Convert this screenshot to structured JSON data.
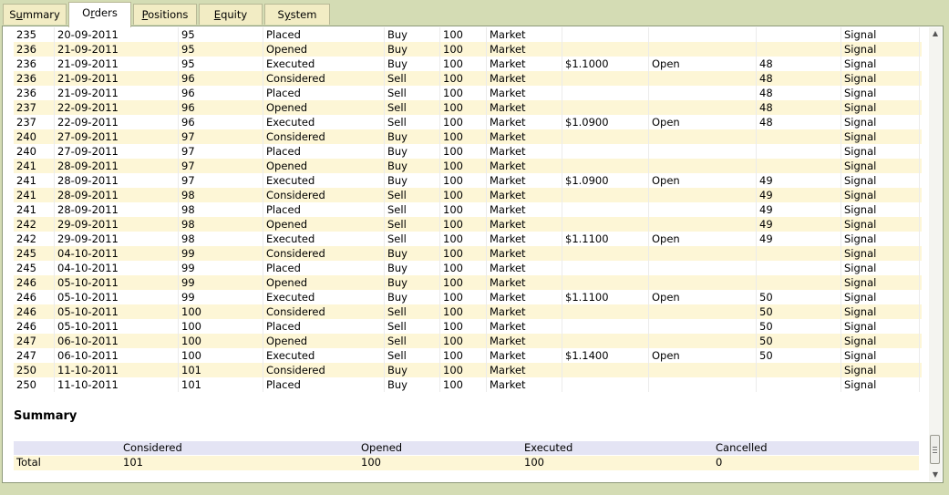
{
  "tabs": [
    {
      "name": "summary",
      "pre": "S",
      "ul": "u",
      "post": "mmary",
      "active": false
    },
    {
      "name": "orders",
      "pre": "O",
      "ul": "r",
      "post": "ders",
      "active": true
    },
    {
      "name": "positions",
      "pre": "",
      "ul": "P",
      "post": "ositions",
      "active": false
    },
    {
      "name": "equity",
      "pre": "",
      "ul": "E",
      "post": "quity",
      "active": false
    },
    {
      "name": "system",
      "pre": "S",
      "ul": "y",
      "post": "stem",
      "active": false
    }
  ],
  "orders": [
    [
      "235",
      "20-09-2011",
      "95",
      "Placed",
      "Buy",
      "100",
      "Market",
      "",
      "",
      "",
      "Signal"
    ],
    [
      "236",
      "21-09-2011",
      "95",
      "Opened",
      "Buy",
      "100",
      "Market",
      "",
      "",
      "",
      "Signal"
    ],
    [
      "236",
      "21-09-2011",
      "95",
      "Executed",
      "Buy",
      "100",
      "Market",
      "$1.1000",
      "Open",
      "48",
      "Signal"
    ],
    [
      "236",
      "21-09-2011",
      "96",
      "Considered",
      "Sell",
      "100",
      "Market",
      "",
      "",
      "48",
      "Signal"
    ],
    [
      "236",
      "21-09-2011",
      "96",
      "Placed",
      "Sell",
      "100",
      "Market",
      "",
      "",
      "48",
      "Signal"
    ],
    [
      "237",
      "22-09-2011",
      "96",
      "Opened",
      "Sell",
      "100",
      "Market",
      "",
      "",
      "48",
      "Signal"
    ],
    [
      "237",
      "22-09-2011",
      "96",
      "Executed",
      "Sell",
      "100",
      "Market",
      "$1.0900",
      "Open",
      "48",
      "Signal"
    ],
    [
      "240",
      "27-09-2011",
      "97",
      "Considered",
      "Buy",
      "100",
      "Market",
      "",
      "",
      "",
      "Signal"
    ],
    [
      "240",
      "27-09-2011",
      "97",
      "Placed",
      "Buy",
      "100",
      "Market",
      "",
      "",
      "",
      "Signal"
    ],
    [
      "241",
      "28-09-2011",
      "97",
      "Opened",
      "Buy",
      "100",
      "Market",
      "",
      "",
      "",
      "Signal"
    ],
    [
      "241",
      "28-09-2011",
      "97",
      "Executed",
      "Buy",
      "100",
      "Market",
      "$1.0900",
      "Open",
      "49",
      "Signal"
    ],
    [
      "241",
      "28-09-2011",
      "98",
      "Considered",
      "Sell",
      "100",
      "Market",
      "",
      "",
      "49",
      "Signal"
    ],
    [
      "241",
      "28-09-2011",
      "98",
      "Placed",
      "Sell",
      "100",
      "Market",
      "",
      "",
      "49",
      "Signal"
    ],
    [
      "242",
      "29-09-2011",
      "98",
      "Opened",
      "Sell",
      "100",
      "Market",
      "",
      "",
      "49",
      "Signal"
    ],
    [
      "242",
      "29-09-2011",
      "98",
      "Executed",
      "Sell",
      "100",
      "Market",
      "$1.1100",
      "Open",
      "49",
      "Signal"
    ],
    [
      "245",
      "04-10-2011",
      "99",
      "Considered",
      "Buy",
      "100",
      "Market",
      "",
      "",
      "",
      "Signal"
    ],
    [
      "245",
      "04-10-2011",
      "99",
      "Placed",
      "Buy",
      "100",
      "Market",
      "",
      "",
      "",
      "Signal"
    ],
    [
      "246",
      "05-10-2011",
      "99",
      "Opened",
      "Buy",
      "100",
      "Market",
      "",
      "",
      "",
      "Signal"
    ],
    [
      "246",
      "05-10-2011",
      "99",
      "Executed",
      "Buy",
      "100",
      "Market",
      "$1.1100",
      "Open",
      "50",
      "Signal"
    ],
    [
      "246",
      "05-10-2011",
      "100",
      "Considered",
      "Sell",
      "100",
      "Market",
      "",
      "",
      "50",
      "Signal"
    ],
    [
      "246",
      "05-10-2011",
      "100",
      "Placed",
      "Sell",
      "100",
      "Market",
      "",
      "",
      "50",
      "Signal"
    ],
    [
      "247",
      "06-10-2011",
      "100",
      "Opened",
      "Sell",
      "100",
      "Market",
      "",
      "",
      "50",
      "Signal"
    ],
    [
      "247",
      "06-10-2011",
      "100",
      "Executed",
      "Sell",
      "100",
      "Market",
      "$1.1400",
      "Open",
      "50",
      "Signal"
    ],
    [
      "250",
      "11-10-2011",
      "101",
      "Considered",
      "Buy",
      "100",
      "Market",
      "",
      "",
      "",
      "Signal"
    ],
    [
      "250",
      "11-10-2011",
      "101",
      "Placed",
      "Buy",
      "100",
      "Market",
      "",
      "",
      "",
      "Signal"
    ]
  ],
  "summary": {
    "title": "Summary",
    "headers": [
      "",
      "Considered",
      "Opened",
      "Executed",
      "Cancelled"
    ],
    "row": [
      "Total",
      "101",
      "100",
      "100",
      "0"
    ]
  },
  "icons": {
    "scroll_up": "arrow-up-icon",
    "scroll_down": "arrow-down-icon"
  },
  "colors": {
    "background": "#d4dcb4",
    "tab": "#f2ecc4",
    "row_alt": "#fdf6d6",
    "summary_header": "#e4e4f4"
  }
}
